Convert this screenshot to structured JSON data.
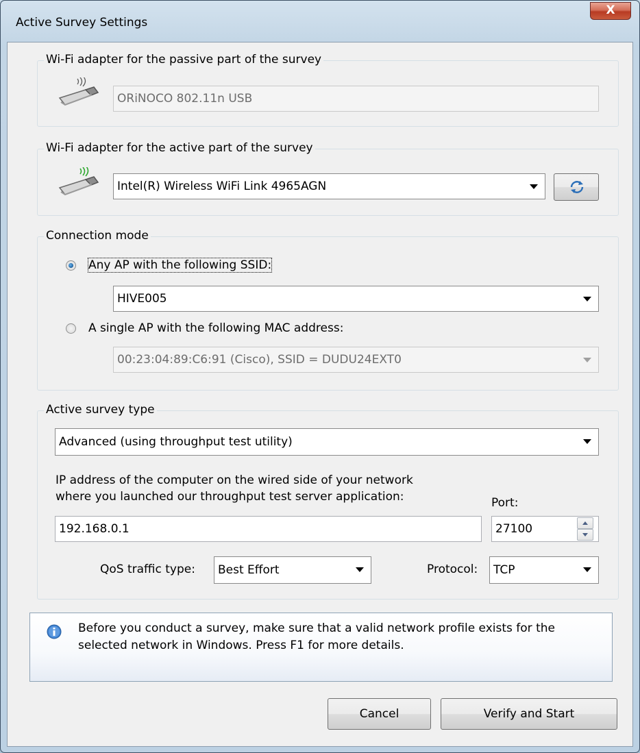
{
  "window": {
    "title": "Active Survey Settings",
    "close_glyph": "X"
  },
  "passive_group": {
    "label": "Wi-Fi adapter for the passive part of the survey",
    "adapter_value": "ORiNOCO 802.11n USB",
    "icon": "usb-wifi-adapter-icon"
  },
  "active_group": {
    "label": "Wi-Fi adapter for the active part of the survey",
    "adapter_value": "Intel(R) Wireless WiFi Link 4965AGN",
    "icon": "usb-wifi-adapter-active-icon",
    "refresh_icon": "refresh-icon"
  },
  "connection_group": {
    "label": "Connection mode",
    "option_ssid_label": "Any AP with the following SSID:",
    "ssid_value": "HIVE005",
    "option_mac_label": "A single AP with the following MAC address:",
    "mac_value": "00:23:04:89:C6:91 (Cisco), SSID = DUDU24EXT0",
    "selected_option": "ssid"
  },
  "survey_group": {
    "label": "Active survey type",
    "type_value": "Advanced (using throughput test utility)",
    "ip_prompt_line1": "IP address of the computer on the wired side of your network",
    "ip_prompt_line2": "where you launched our throughput test server application:",
    "port_label": "Port:",
    "ip_value": "192.168.0.1",
    "port_value": "27100",
    "qos_label": "QoS traffic type:",
    "qos_value": "Best Effort",
    "protocol_label": "Protocol:",
    "protocol_value": "TCP"
  },
  "info": {
    "icon": "info-icon",
    "line1": "Before you conduct a survey, make sure that a valid network profile exists for the",
    "line2": "selected network in Windows. Press F1 for more details."
  },
  "buttons": {
    "cancel": "Cancel",
    "verify_start": "Verify and Start"
  },
  "colors": {
    "accent": "#1d5f9a",
    "wifi_active": "#2ea82e",
    "wifi_passive": "#5a5a5a"
  }
}
